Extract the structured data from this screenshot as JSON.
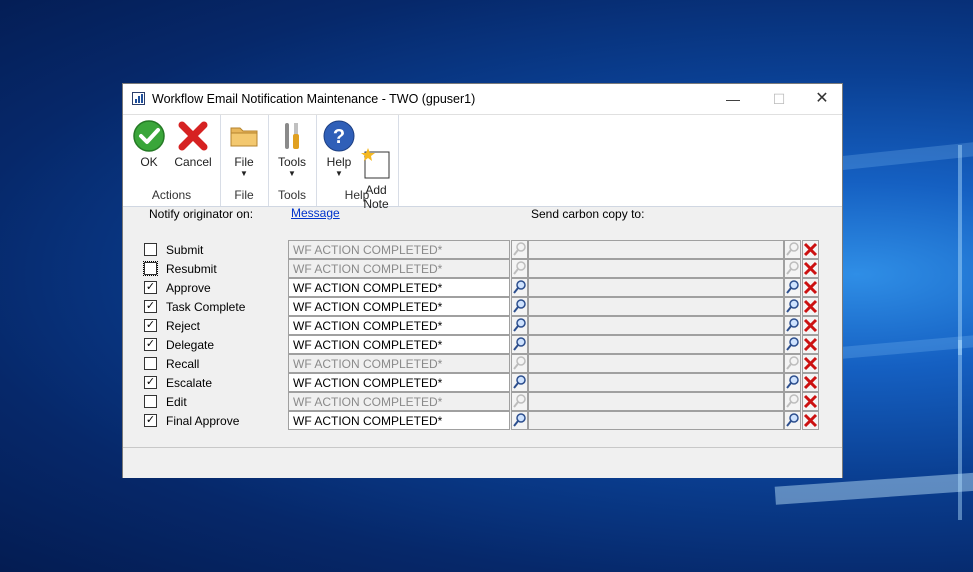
{
  "window": {
    "title": "Workflow Email Notification Maintenance  -  TWO (gpuser1)",
    "controls": {
      "minimize": "—",
      "maximize": "☐",
      "close": "✕"
    }
  },
  "ribbon": {
    "groups": [
      {
        "label": "Actions",
        "buttons": [
          {
            "label": "OK",
            "icon": "ok-checkmark-icon"
          },
          {
            "label": "Cancel",
            "icon": "cancel-x-icon"
          }
        ]
      },
      {
        "label": "File",
        "buttons": [
          {
            "label": "File",
            "icon": "folder-icon",
            "dropdown": true
          }
        ]
      },
      {
        "label": "Tools",
        "buttons": [
          {
            "label": "Tools",
            "icon": "tools-icon",
            "dropdown": true
          }
        ]
      },
      {
        "label": "Help",
        "buttons": [
          {
            "label": "Help",
            "icon": "help-icon",
            "dropdown": true
          },
          {
            "label": "Add\nNote",
            "icon": "add-note-icon"
          }
        ]
      }
    ]
  },
  "headers": {
    "notify": "Notify originator on:",
    "message": "Message",
    "cc": "Send carbon copy to:"
  },
  "rows": [
    {
      "label": "Submit",
      "checked": false,
      "message": "WF ACTION COMPLETED*",
      "enabled": false,
      "cc": ""
    },
    {
      "label": "Resubmit",
      "checked": false,
      "focused": true,
      "message": "WF ACTION COMPLETED*",
      "enabled": false,
      "cc": ""
    },
    {
      "label": "Approve",
      "checked": true,
      "message": "WF ACTION COMPLETED*",
      "enabled": true,
      "cc": ""
    },
    {
      "label": "Task Complete",
      "checked": true,
      "message": "WF ACTION COMPLETED*",
      "enabled": true,
      "cc": ""
    },
    {
      "label": "Reject",
      "checked": true,
      "message": "WF ACTION COMPLETED*",
      "enabled": true,
      "cc": ""
    },
    {
      "label": "Delegate",
      "checked": true,
      "message": "WF ACTION COMPLETED*",
      "enabled": true,
      "cc": ""
    },
    {
      "label": "Recall",
      "checked": false,
      "message": "WF ACTION COMPLETED*",
      "enabled": false,
      "cc": ""
    },
    {
      "label": "Escalate",
      "checked": true,
      "message": "WF ACTION COMPLETED*",
      "enabled": true,
      "cc": ""
    },
    {
      "label": "Edit",
      "checked": false,
      "message": "WF ACTION COMPLETED*",
      "enabled": false,
      "cc": ""
    },
    {
      "label": "Final Approve",
      "checked": true,
      "message": "WF ACTION COMPLETED*",
      "enabled": true,
      "cc": ""
    }
  ],
  "colors": {
    "accent": "#0033cc",
    "delete": "#cc1111",
    "ok": "#2f9e2f"
  }
}
